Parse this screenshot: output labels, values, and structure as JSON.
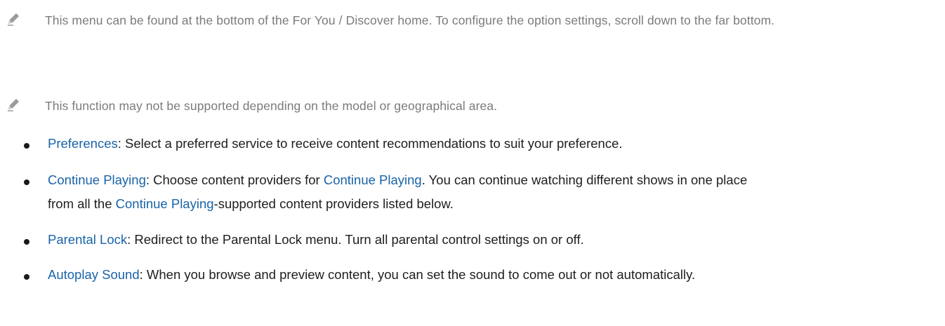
{
  "notes": [
    {
      "icon": "pencil-icon",
      "text": "This menu can be found at the bottom of the For You / Discover home. To configure the option settings, scroll down to the far bottom."
    },
    {
      "icon": "pencil-icon",
      "text": "This function may not be supported depending on the model or geographical area."
    }
  ],
  "items": [
    {
      "term": "Preferences",
      "desc": ": Select a preferred service to receive content recommendations to suit your preference."
    },
    {
      "term": "Continue Playing",
      "desc_a": ": Choose content providers for ",
      "term2": "Continue Playing",
      "desc_b": ". You can continue watching different shows in one place from all the ",
      "term3": "Continue Playing",
      "desc_c": "-supported content providers listed below."
    },
    {
      "term": "Parental Lock",
      "desc": ": Redirect to the Parental Lock menu. Turn all parental control settings on or off."
    },
    {
      "term": "Autoplay Sound",
      "desc": ": When you browse and preview content, you can set the sound to come out or not automatically."
    }
  ],
  "colors": {
    "term": "#1a63a8",
    "note_text": "#7b7b7b",
    "body_text": "#1e1e1e"
  }
}
